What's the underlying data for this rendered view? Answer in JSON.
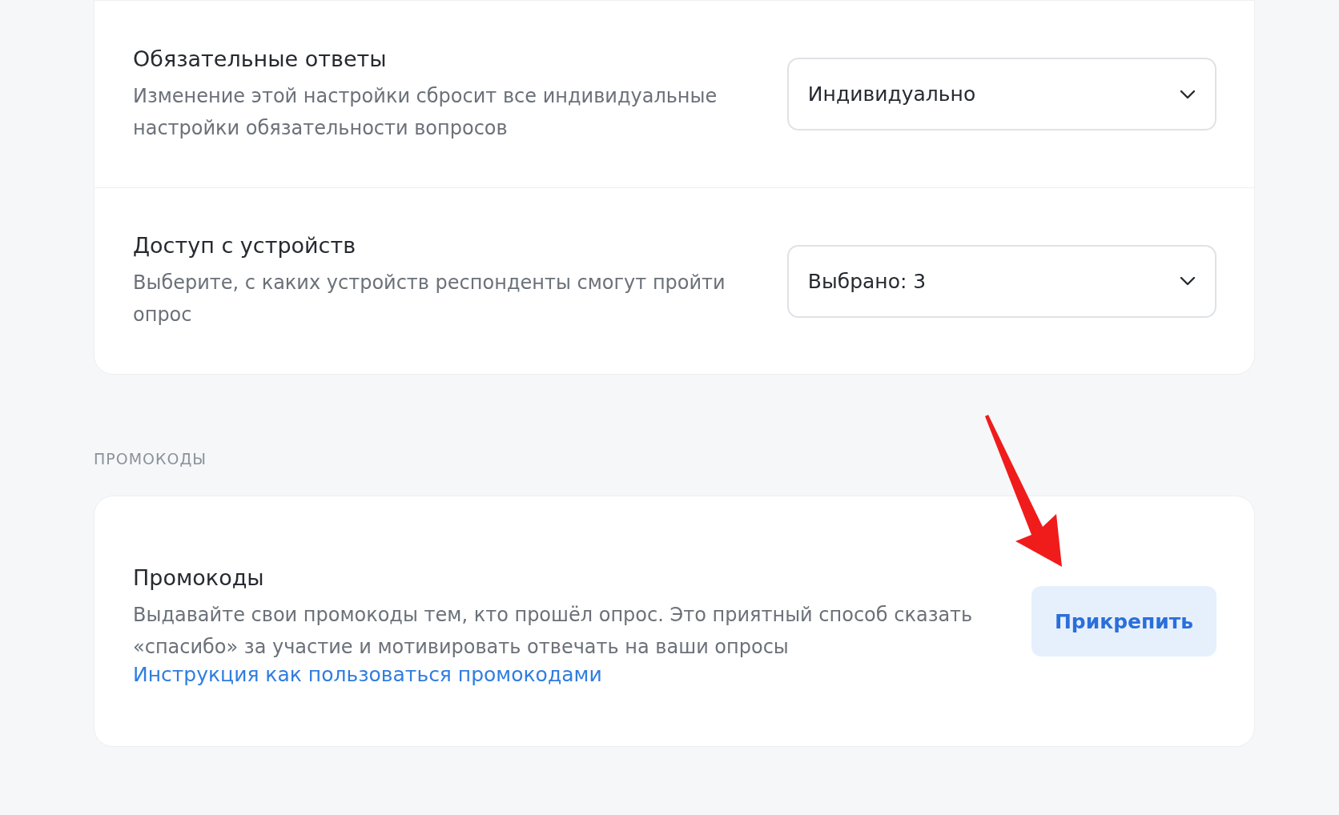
{
  "settings": [
    {
      "title": "Обязательные ответы",
      "description": "Изменение этой настройки сбросит все индивидуальные настройки обязательности вопросов",
      "value": "Индивидуально"
    },
    {
      "title": "Доступ с устройств",
      "description": "Выберите, с каких устройств респонденты смогут пройти опрос",
      "value": "Выбрано: 3"
    }
  ],
  "promo_section": {
    "label": "ПРОМОКОДЫ",
    "title": "Промокоды",
    "description": "Выдавайте свои промокоды тем, кто прошёл опрос. Это приятный способ сказать «спасибо» за участие и мотивировать отвечать на ваши опросы",
    "link": "Инструкция как пользоваться промокодами",
    "button": "Прикрепить"
  }
}
